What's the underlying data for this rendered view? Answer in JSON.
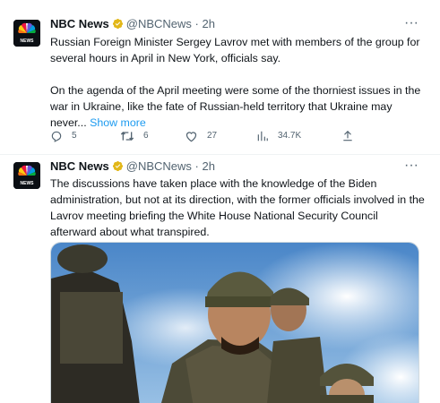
{
  "tweets": [
    {
      "author": "NBC News",
      "handle": "@NBCNews",
      "dot": "·",
      "time": "2h",
      "avatar_label": "NEWS",
      "text_p1": "Russian Foreign Minister Sergey Lavrov met with members of the group for several hours in April in New York, officials say.",
      "text_p2": "On the agenda of the April meeting were some of the thorniest issues in the war in Ukraine, like the fate of Russian-held territory that Ukraine may never...",
      "show_more": "Show more",
      "stats": {
        "replies": "5",
        "retweets": "6",
        "likes": "27",
        "views": "34.7K"
      }
    },
    {
      "author": "NBC News",
      "handle": "@NBCNews",
      "dot": "·",
      "time": "2h",
      "avatar_label": "NEWS",
      "text_p1": "The discussions have taken place with the knowledge of the Biden administration, but not at its direction, with the former officials involved in the Lavrov meeting briefing the White House National Security Council afterward about what transpired."
    }
  ],
  "colors": {
    "accent": "#1d9bf0",
    "text": "#0f1419",
    "secondary": "#536471",
    "verified_gold": "#e2b719",
    "divider": "#eff3f4"
  },
  "icons": {
    "verified": "verified-badge-icon",
    "more": "more-options-icon",
    "reply": "reply-icon",
    "retweet": "retweet-icon",
    "like": "heart-icon",
    "views": "views-chart-icon",
    "share": "share-icon",
    "logo": "nbc-peacock-logo"
  }
}
